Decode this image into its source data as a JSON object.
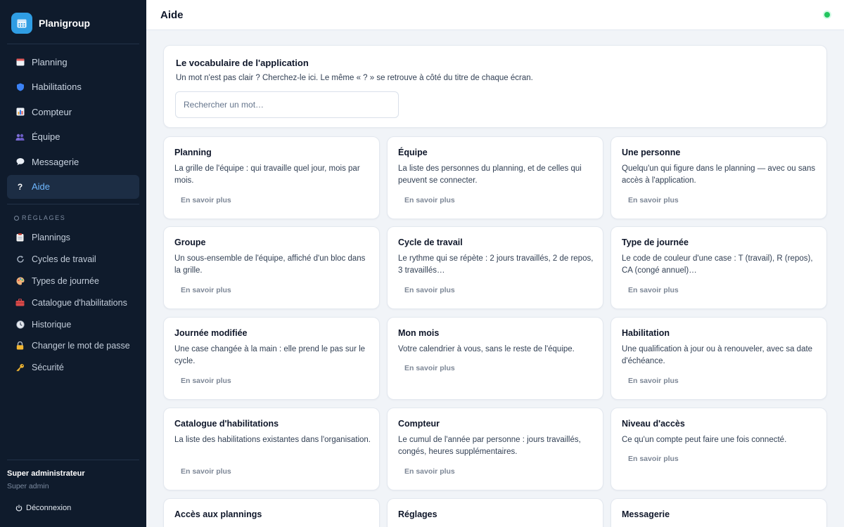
{
  "app": {
    "name": "Planigroup"
  },
  "nav": [
    {
      "label": "Planning",
      "icon": "calendar-icon"
    },
    {
      "label": "Habilitations",
      "icon": "shield-icon"
    },
    {
      "label": "Compteur",
      "icon": "bar-chart-icon"
    },
    {
      "label": "Équipe",
      "icon": "people-icon"
    },
    {
      "label": "Messagerie",
      "icon": "speech-bubble-icon"
    },
    {
      "label": "Aide",
      "icon": "question-icon",
      "active": true
    }
  ],
  "settings": {
    "title": "RÉGLAGES",
    "items": [
      {
        "label": "Plannings",
        "icon": "clipboard-icon"
      },
      {
        "label": "Cycles de travail",
        "icon": "refresh-icon"
      },
      {
        "label": "Types de journée",
        "icon": "palette-icon"
      },
      {
        "label": "Catalogue d'habilitations",
        "icon": "toolbox-icon"
      },
      {
        "label": "Historique",
        "icon": "clock-icon"
      },
      {
        "label": "Changer le mot de passe",
        "icon": "lock-icon"
      },
      {
        "label": "Sécurité",
        "icon": "key-icon"
      }
    ]
  },
  "user": {
    "role": "Super administrateur",
    "subtitle": "Super admin"
  },
  "logout_label": "Déconnexion",
  "header": {
    "title": "Aide",
    "status_color": "#22c55e"
  },
  "intro": {
    "title": "Le vocabulaire de l'application",
    "description": "Un mot n'est pas clair ? Cherchez-le ici. Le même « ? » se retrouve à côté du titre de chaque écran.",
    "search_placeholder": "Rechercher un mot…",
    "search_value": ""
  },
  "learn_more_label": "En savoir plus",
  "terms": [
    {
      "title": "Planning",
      "description": "La grille de l'équipe : qui travaille quel jour, mois par mois."
    },
    {
      "title": "Équipe",
      "description": "La liste des personnes du planning, et de celles qui peuvent se connecter."
    },
    {
      "title": "Une personne",
      "description": "Quelqu'un qui figure dans le planning — avec ou sans accès à l'application."
    },
    {
      "title": "Groupe",
      "description": "Un sous-ensemble de l'équipe, affiché d'un bloc dans la grille."
    },
    {
      "title": "Cycle de travail",
      "description": "Le rythme qui se répète : 2 jours travaillés, 2 de repos, 3 travaillés…"
    },
    {
      "title": "Type de journée",
      "description": "Le code de couleur d'une case : T (travail), R (repos), CA (congé annuel)…"
    },
    {
      "title": "Journée modifiée",
      "description": "Une case changée à la main : elle prend le pas sur le cycle."
    },
    {
      "title": "Mon mois",
      "description": "Votre calendrier à vous, sans le reste de l'équipe."
    },
    {
      "title": "Habilitation",
      "description": "Une qualification à jour ou à renouveler, avec sa date d'échéance."
    },
    {
      "title": "Catalogue d'habilitations",
      "description": "La liste des habilitations existantes dans l'organisation."
    },
    {
      "title": "Compteur",
      "description": "Le cumul de l'année par personne : jours travaillés, congés, heures supplémentaires."
    },
    {
      "title": "Niveau d'accès",
      "description": "Ce qu'un compte peut faire une fois connecté."
    },
    {
      "title": "Accès aux plannings",
      "description": ""
    },
    {
      "title": "Réglages",
      "description": ""
    },
    {
      "title": "Messagerie",
      "description": ""
    }
  ]
}
